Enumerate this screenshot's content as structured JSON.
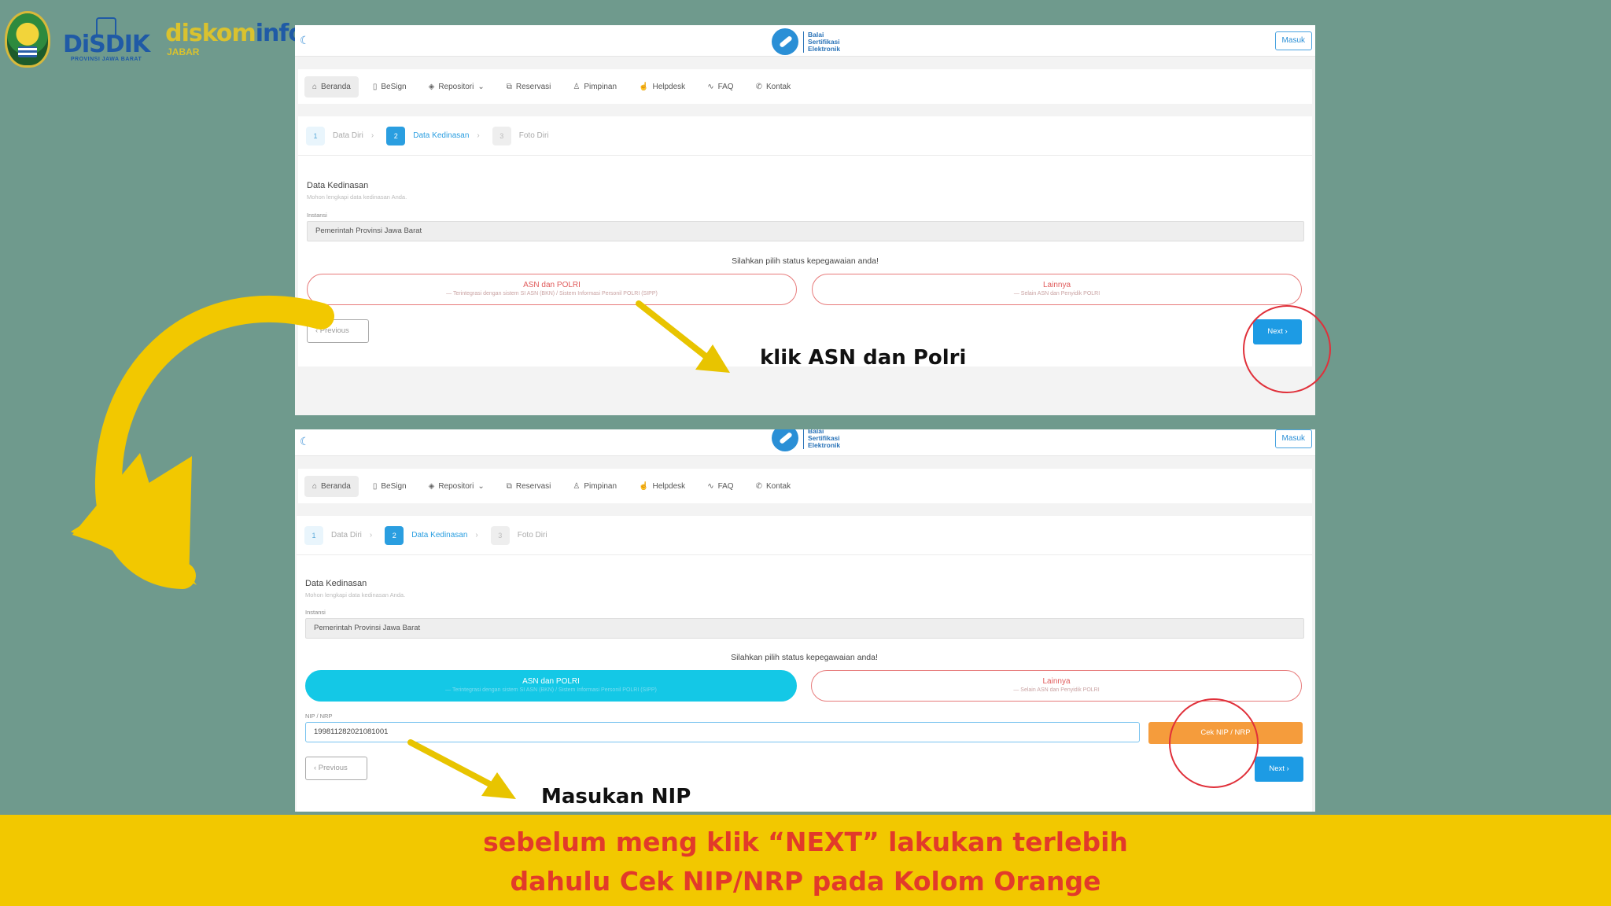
{
  "logos": {
    "disdik": "DiSDIK",
    "disdik_sub": "PROVINSI JAWA BARAT",
    "diskominfo_a": "diskom",
    "diskominfo_b": "info",
    "diskominfo_sub": "JABAR"
  },
  "app": {
    "brand_line1": "Balai",
    "brand_line2": "Sertifikasi",
    "brand_line3": "Elektronik",
    "login_label": "Masuk"
  },
  "nav": [
    "Beranda",
    "BeSign",
    "Repositori",
    "Reservasi",
    "Pimpinan",
    "Helpdesk",
    "FAQ",
    "Kontak"
  ],
  "steps": [
    {
      "num": "1",
      "label": "Data Diri"
    },
    {
      "num": "2",
      "label": "Data Kedinasan"
    },
    {
      "num": "3",
      "label": "Foto Diri"
    }
  ],
  "form": {
    "title": "Data Kedinasan",
    "subtitle": "Mohon lengkapi data kedinasan Anda.",
    "instansi_label": "Instansi",
    "instansi_value": "Pemerintah Provinsi Jawa Barat",
    "prompt": "Silahkan pilih status kepegawaian anda!",
    "choice_asn_title": "ASN dan POLRI",
    "choice_asn_desc": "— Terintegrasi dengan sistem SI ASN (BKN) / Sistem Informasi Personil POLRI (SIPP)",
    "choice_other_title": "Lainnya",
    "choice_other_desc": "— Selain ASN dan Penyidik POLRI",
    "prev_label": "‹  Previous",
    "next_label": "Next  ›",
    "nip_label": "NIP / NRP",
    "nip_value": "199811282021081001",
    "cek_label": "Cek NIP / NRP"
  },
  "annotations": {
    "top": "klik ASN dan Polri",
    "bottom": "Masukan NIP"
  },
  "footer": {
    "line1": "sebelum meng klik “NEXT” lakukan terlebih",
    "line2": "dahulu Cek NIP/NRP pada Kolom Orange"
  },
  "colors": {
    "background": "#6f9a8d",
    "arrow": "#f2c800",
    "footer_bg": "#f2c800",
    "footer_text": "#e23a2a",
    "circle": "#e0303a",
    "next_button": "#1d9be4",
    "cek_button": "#f59c3c",
    "selected_choice": "#14c8e6"
  }
}
